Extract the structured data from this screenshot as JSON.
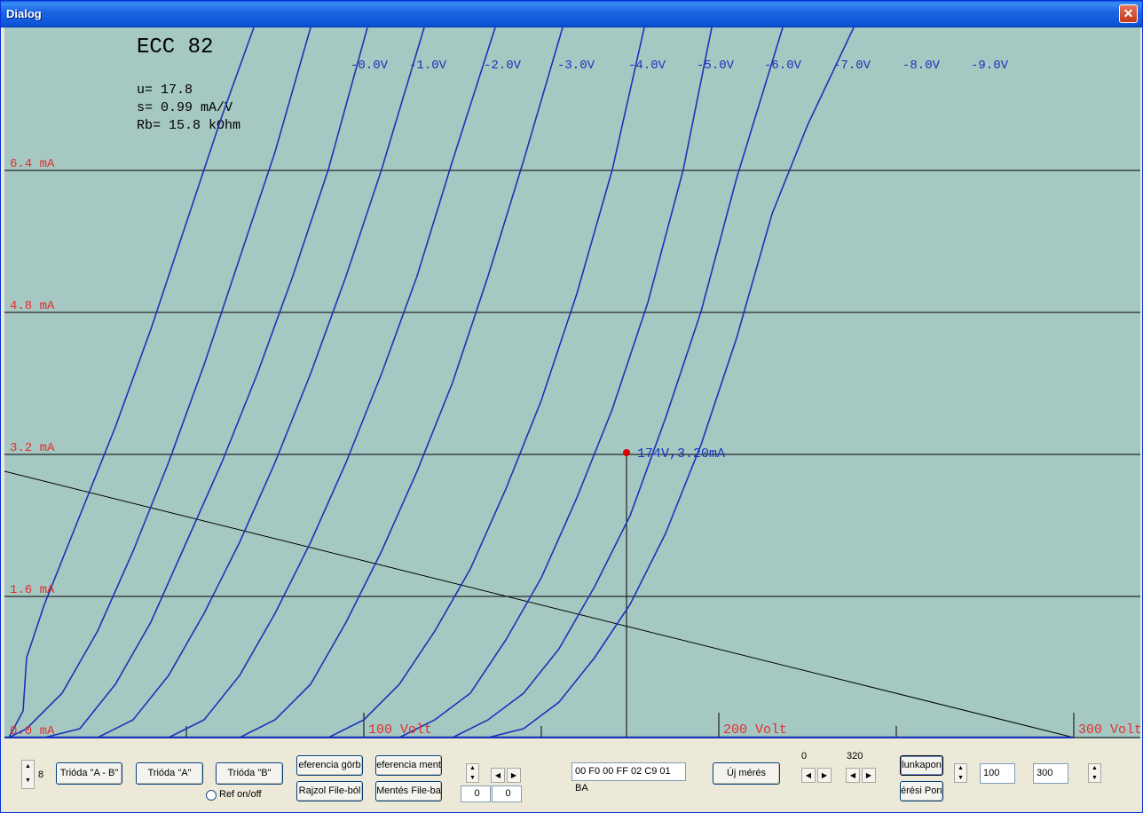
{
  "window": {
    "title": "Dialog",
    "close_glyph": "✕"
  },
  "colors": {
    "plot_bg": "#A6C8C3",
    "curve": "#1A33B8",
    "ylabel": "#E03030",
    "grid": "#000000",
    "point": "#E00000"
  },
  "info": {
    "tube": "ECC 82",
    "mu": "u= 17.8",
    "s": "s= 0.99 mA/V",
    "rb": "Rb= 15.8 kOhm"
  },
  "chart_data": {
    "type": "line",
    "title": "ECC 82",
    "xlabel": "Volt",
    "ylabel": "mA",
    "xlim": [
      0,
      300
    ],
    "ylim": [
      0,
      8
    ],
    "x_ticks": [
      0,
      50,
      100,
      150,
      200,
      250,
      300
    ],
    "x_tick_labels": [
      "100 Volt",
      "200 Volt",
      "300 Volt"
    ],
    "y_tick_labels": [
      "0.0 mA",
      "1.6 mA",
      "3.2 mA",
      "4.8 mA",
      "6.4 mA"
    ],
    "y_ticks": [
      0,
      1.6,
      3.2,
      4.8,
      6.4
    ],
    "series": [
      {
        "name": "-0.0V",
        "points": [
          [
            0,
            0
          ],
          [
            4,
            0.3
          ],
          [
            5,
            0.9
          ],
          [
            10,
            1.5
          ],
          [
            20,
            2.5
          ],
          [
            30,
            3.5
          ],
          [
            40,
            4.6
          ],
          [
            50,
            5.8
          ],
          [
            60,
            7.0
          ],
          [
            69,
            8.0
          ]
        ]
      },
      {
        "name": "-1.0V",
        "points": [
          [
            0,
            0
          ],
          [
            5,
            0.1
          ],
          [
            15,
            0.5
          ],
          [
            25,
            1.2
          ],
          [
            35,
            2.1
          ],
          [
            45,
            3.1
          ],
          [
            55,
            4.2
          ],
          [
            65,
            5.4
          ],
          [
            75,
            6.6
          ],
          [
            85,
            8.0
          ]
        ]
      },
      {
        "name": "-2.0V",
        "points": [
          [
            10,
            0
          ],
          [
            20,
            0.1
          ],
          [
            30,
            0.6
          ],
          [
            40,
            1.3
          ],
          [
            50,
            2.2
          ],
          [
            60,
            3.1
          ],
          [
            70,
            4.1
          ],
          [
            80,
            5.2
          ],
          [
            90,
            6.4
          ],
          [
            101,
            8.0
          ]
        ]
      },
      {
        "name": "-3.0V",
        "points": [
          [
            25,
            0
          ],
          [
            35,
            0.2
          ],
          [
            45,
            0.7
          ],
          [
            55,
            1.4
          ],
          [
            65,
            2.2
          ],
          [
            75,
            3.1
          ],
          [
            85,
            4.1
          ],
          [
            95,
            5.2
          ],
          [
            105,
            6.4
          ],
          [
            117,
            8.0
          ]
        ]
      },
      {
        "name": "-4.0V",
        "points": [
          [
            45,
            0
          ],
          [
            55,
            0.2
          ],
          [
            65,
            0.7
          ],
          [
            75,
            1.4
          ],
          [
            85,
            2.2
          ],
          [
            95,
            3.1
          ],
          [
            105,
            4.1
          ],
          [
            115,
            5.2
          ],
          [
            125,
            6.5
          ],
          [
            137,
            8.0
          ]
        ]
      },
      {
        "name": "-5.0V",
        "points": [
          [
            65,
            0
          ],
          [
            75,
            0.2
          ],
          [
            85,
            0.6
          ],
          [
            95,
            1.3
          ],
          [
            105,
            2.1
          ],
          [
            115,
            3.0
          ],
          [
            125,
            4.0
          ],
          [
            135,
            5.2
          ],
          [
            145,
            6.5
          ],
          [
            156,
            8.0
          ]
        ]
      },
      {
        "name": "-6.0V",
        "points": [
          [
            90,
            0
          ],
          [
            100,
            0.2
          ],
          [
            110,
            0.6
          ],
          [
            120,
            1.2
          ],
          [
            130,
            1.9
          ],
          [
            140,
            2.8
          ],
          [
            150,
            3.8
          ],
          [
            160,
            5.0
          ],
          [
            170,
            6.4
          ],
          [
            179,
            8.0
          ]
        ]
      },
      {
        "name": "-7.0V",
        "points": [
          [
            110,
            0
          ],
          [
            120,
            0.2
          ],
          [
            130,
            0.5
          ],
          [
            140,
            1.1
          ],
          [
            150,
            1.8
          ],
          [
            160,
            2.7
          ],
          [
            170,
            3.7
          ],
          [
            180,
            4.9
          ],
          [
            190,
            6.4
          ],
          [
            198,
            8.0
          ]
        ]
      },
      {
        "name": "-8.0V",
        "points": [
          [
            125,
            0
          ],
          [
            135,
            0.2
          ],
          [
            145,
            0.5
          ],
          [
            155,
            1.0
          ],
          [
            165,
            1.7
          ],
          [
            175,
            2.5
          ],
          [
            185,
            3.6
          ],
          [
            195,
            4.8
          ],
          [
            205,
            6.3
          ],
          [
            218,
            8.0
          ]
        ]
      },
      {
        "name": "-9.0V",
        "points": [
          [
            135,
            0
          ],
          [
            145,
            0.1
          ],
          [
            155,
            0.4
          ],
          [
            165,
            0.9
          ],
          [
            175,
            1.5
          ],
          [
            185,
            2.3
          ],
          [
            195,
            3.3
          ],
          [
            205,
            4.5
          ],
          [
            215,
            5.9
          ],
          [
            225,
            6.9
          ],
          [
            238,
            8.0
          ]
        ]
      }
    ],
    "load_line": {
      "points": [
        [
          0,
          3.0
        ],
        [
          300,
          0
        ]
      ]
    },
    "operating_point": {
      "x": 174,
      "y": 3.2,
      "label": "174V,3.20mA"
    }
  },
  "controls": {
    "spin_value": "8",
    "trioda_ab": "Trióda \"A - B\"",
    "trioda_a": "Trióda  \"A\"",
    "trioda_b": "Trióda  \"B\"",
    "ref_onoff": "Ref on/off",
    "referencia_gorbe": "eferencia görb",
    "referencia_mentes": "eferencia ment",
    "rajzol_file": "Rajzol File-ból",
    "mentes_file": "Mentés File-ba",
    "edit_left1": "0",
    "edit_left2": "0",
    "hex_field": "00 F0 00 FF 02 C9 01 BA",
    "uj_meres": "Új mérés",
    "label_0": "0",
    "label_320": "320",
    "munkapont": "lunkapon",
    "meresi_pont": "érési Pont",
    "edit_100": "100",
    "edit_300": "300",
    "spin_up": "▲",
    "spin_down": "▼",
    "arrow_left": "◀",
    "arrow_right": "▶"
  }
}
